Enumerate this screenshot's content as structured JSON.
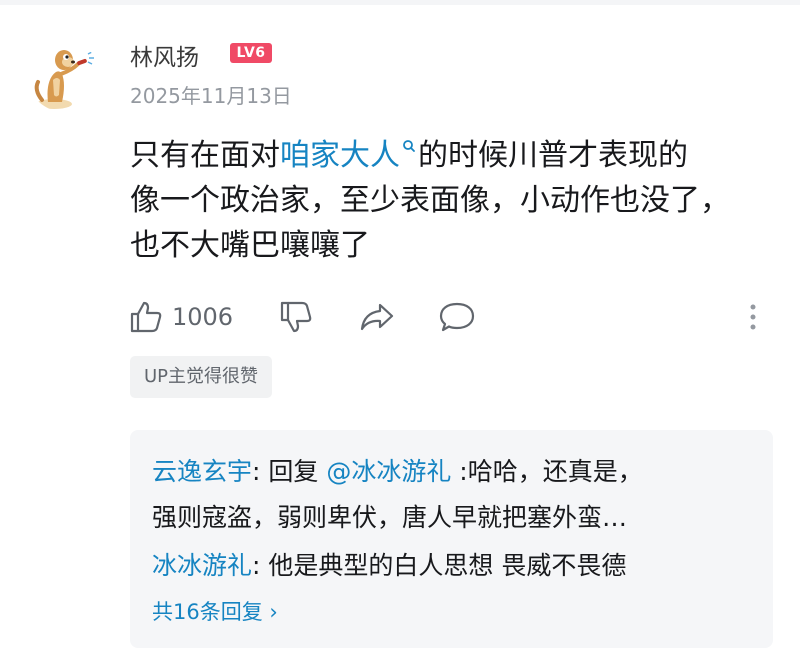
{
  "comment": {
    "user": {
      "name": "林风扬",
      "level_badge": "LV6",
      "level_color": "#f04a66",
      "avatar": "cartoon-meerkat-avatar"
    },
    "date": "2025年11月13日",
    "content": {
      "line1_before": "只有在面对",
      "keyword": "咱家大人",
      "line1_after": "的时候川普才表现的",
      "line2": "像一个政治家，至少表面像，小动作也没了，",
      "line3": "也不大嘴巴嚷嚷了"
    },
    "actions": {
      "like_count": "1006",
      "icons": [
        "thumbs-up-icon",
        "thumbs-down-icon",
        "share-icon",
        "comment-icon",
        "more-icon"
      ]
    },
    "up_tag": "UP主觉得很赞"
  },
  "replies": {
    "items": [
      {
        "name": "云逸玄宇",
        "colon": ": ",
        "reply_word": "回复 ",
        "mention": "@冰冰游礼",
        "text_line1": " :哈哈，还真是，",
        "text_line2": "强则寇盗，弱则卑伏，唐人早就把塞外蛮…"
      },
      {
        "name": "冰冰游礼",
        "colon": ": ",
        "text": "他是典型的白人思想 畏威不畏德"
      }
    ],
    "more_label": "共16条回复 ›"
  },
  "colors": {
    "link_blue": "#1684c2",
    "muted_gray": "#9499a0",
    "text": "#18191c",
    "reply_bg": "#f5f6f8"
  }
}
